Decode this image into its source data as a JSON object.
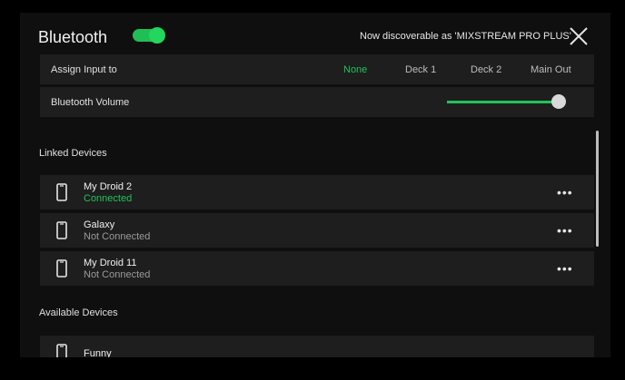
{
  "header": {
    "title": "Bluetooth",
    "toggle_on": true,
    "discoverable_text": "Now discoverable as 'MIXSTREAM PRO PLUS'",
    "close_icon": "close-icon"
  },
  "assign_input": {
    "label": "Assign Input to",
    "options": [
      "None",
      "Deck 1",
      "Deck 2",
      "Main Out"
    ],
    "selected": "None"
  },
  "volume": {
    "label": "Bluetooth Volume",
    "level": 0.97
  },
  "linked": {
    "heading": "Linked Devices",
    "devices": [
      {
        "name": "My Droid 2",
        "status": "Connected"
      },
      {
        "name": "Galaxy",
        "status": "Not Connected"
      },
      {
        "name": "My Droid 11",
        "status": "Not Connected"
      }
    ]
  },
  "available": {
    "heading": "Available Devices",
    "devices": [
      {
        "name": "Funny"
      }
    ]
  },
  "colors": {
    "accent": "#21c25a",
    "row_bg": "#1e1e1e",
    "panel_bg": "#0f0f0f"
  }
}
